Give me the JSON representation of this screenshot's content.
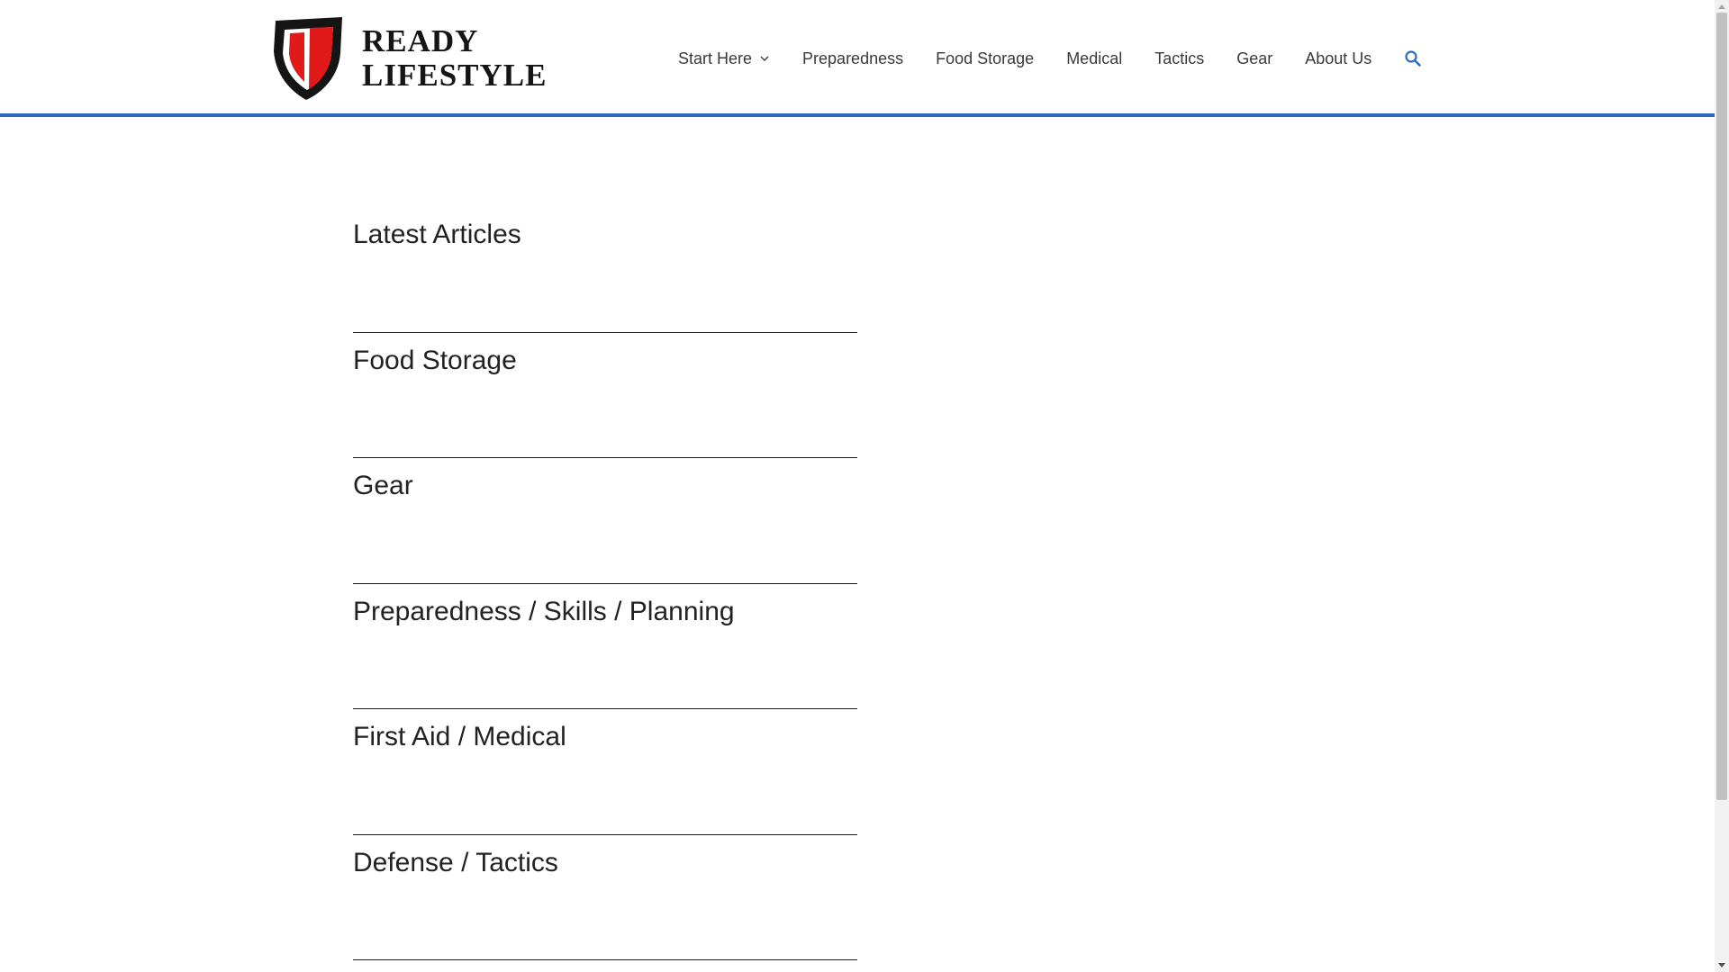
{
  "header": {
    "logo": {
      "line1": "READY",
      "line2": "LIFESTYLE",
      "shield_outer_color": "#151515",
      "shield_red_color": "#e11919"
    },
    "nav": {
      "start_here": "Start Here",
      "preparedness": "Preparedness",
      "food_storage": "Food Storage",
      "medical": "Medical",
      "tactics": "Tactics",
      "gear": "Gear",
      "about_us": "About Us",
      "search_icon": "search-icon",
      "dropdown_icon": "chevron-down-icon"
    },
    "accent_color": "#2a6cc0"
  },
  "sections": [
    {
      "title": "Latest Articles"
    },
    {
      "title": "Food Storage"
    },
    {
      "title": "Gear"
    },
    {
      "title": "Preparedness / Skills / Planning"
    },
    {
      "title": "First Aid / Medical"
    },
    {
      "title": "Defense / Tactics"
    }
  ]
}
